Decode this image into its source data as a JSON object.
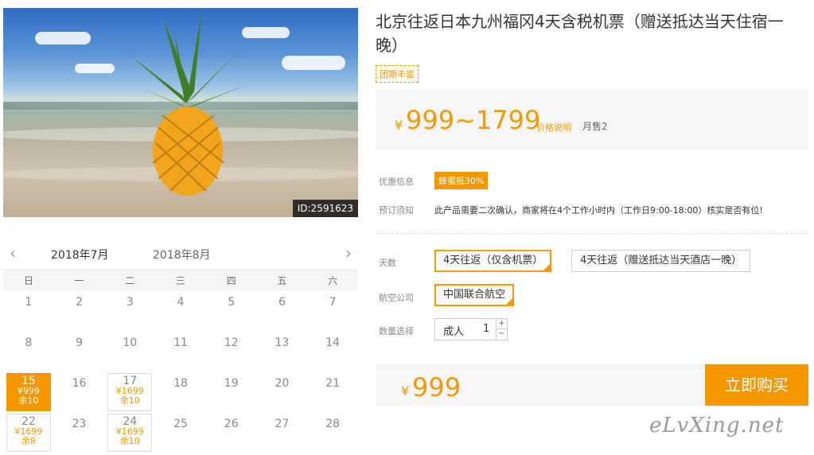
{
  "photo": {
    "id_badge": "ID:2591623"
  },
  "calendar": {
    "prev_icon": "‹",
    "next_icon": "›",
    "months": [
      "2018年7月",
      "2018年8月"
    ],
    "weekdays": [
      "日",
      "一",
      "二",
      "三",
      "四",
      "五",
      "六"
    ],
    "days": {
      "d1": "1",
      "d2": "2",
      "d3": "3",
      "d4": "4",
      "d5": "5",
      "d6": "6",
      "d7": "7",
      "d8": "8",
      "d9": "9",
      "d10": "10",
      "d11": "11",
      "d12": "12",
      "d13": "13",
      "d14": "14",
      "d15": "15",
      "d16": "16",
      "d17": "17",
      "d18": "18",
      "d19": "19",
      "d20": "20",
      "d21": "21",
      "d22": "22",
      "d23": "23",
      "d24": "24",
      "d25": "25",
      "d26": "26",
      "d27": "27",
      "d28": "28"
    },
    "prices": {
      "d15": {
        "price": "¥999",
        "stock": "余10"
      },
      "d17": {
        "price": "¥1699",
        "stock": "余10"
      },
      "d22": {
        "price": "¥1699",
        "stock": "余8"
      },
      "d24": {
        "price": "¥1699",
        "stock": "余10"
      }
    }
  },
  "product": {
    "title": "北京往返日本九州福冈4天含税机票（赠送抵达当天住宿一晚）",
    "tag": "团期丰富",
    "currency": "¥",
    "price_range": "999~1799",
    "price_explain": "价格说明",
    "monthly_sales": "月售2",
    "promo_label": "优惠信息",
    "promo_badge": "蜂蜜抵30%",
    "notice_label": "预订须知",
    "notice_text": "此产品需要二次确认，商家将在4个工作小时内（工作日9:00-18:00）核实是否有位!",
    "days_label": "天数",
    "day_options": [
      "4天往返（仅含机票）",
      "4天往返（赠送抵达当天酒店一晚）"
    ],
    "airline_label": "航空公司",
    "airline": "中国联合航空",
    "qty_label": "数量选择",
    "qty_type": "成人",
    "qty_value": "1",
    "qty_plus": "+",
    "qty_minus": "−",
    "final_price": "999",
    "buy_label": "立即购买"
  },
  "watermark": "eLvXing.net",
  "colors": {
    "accent": "#f39800"
  }
}
